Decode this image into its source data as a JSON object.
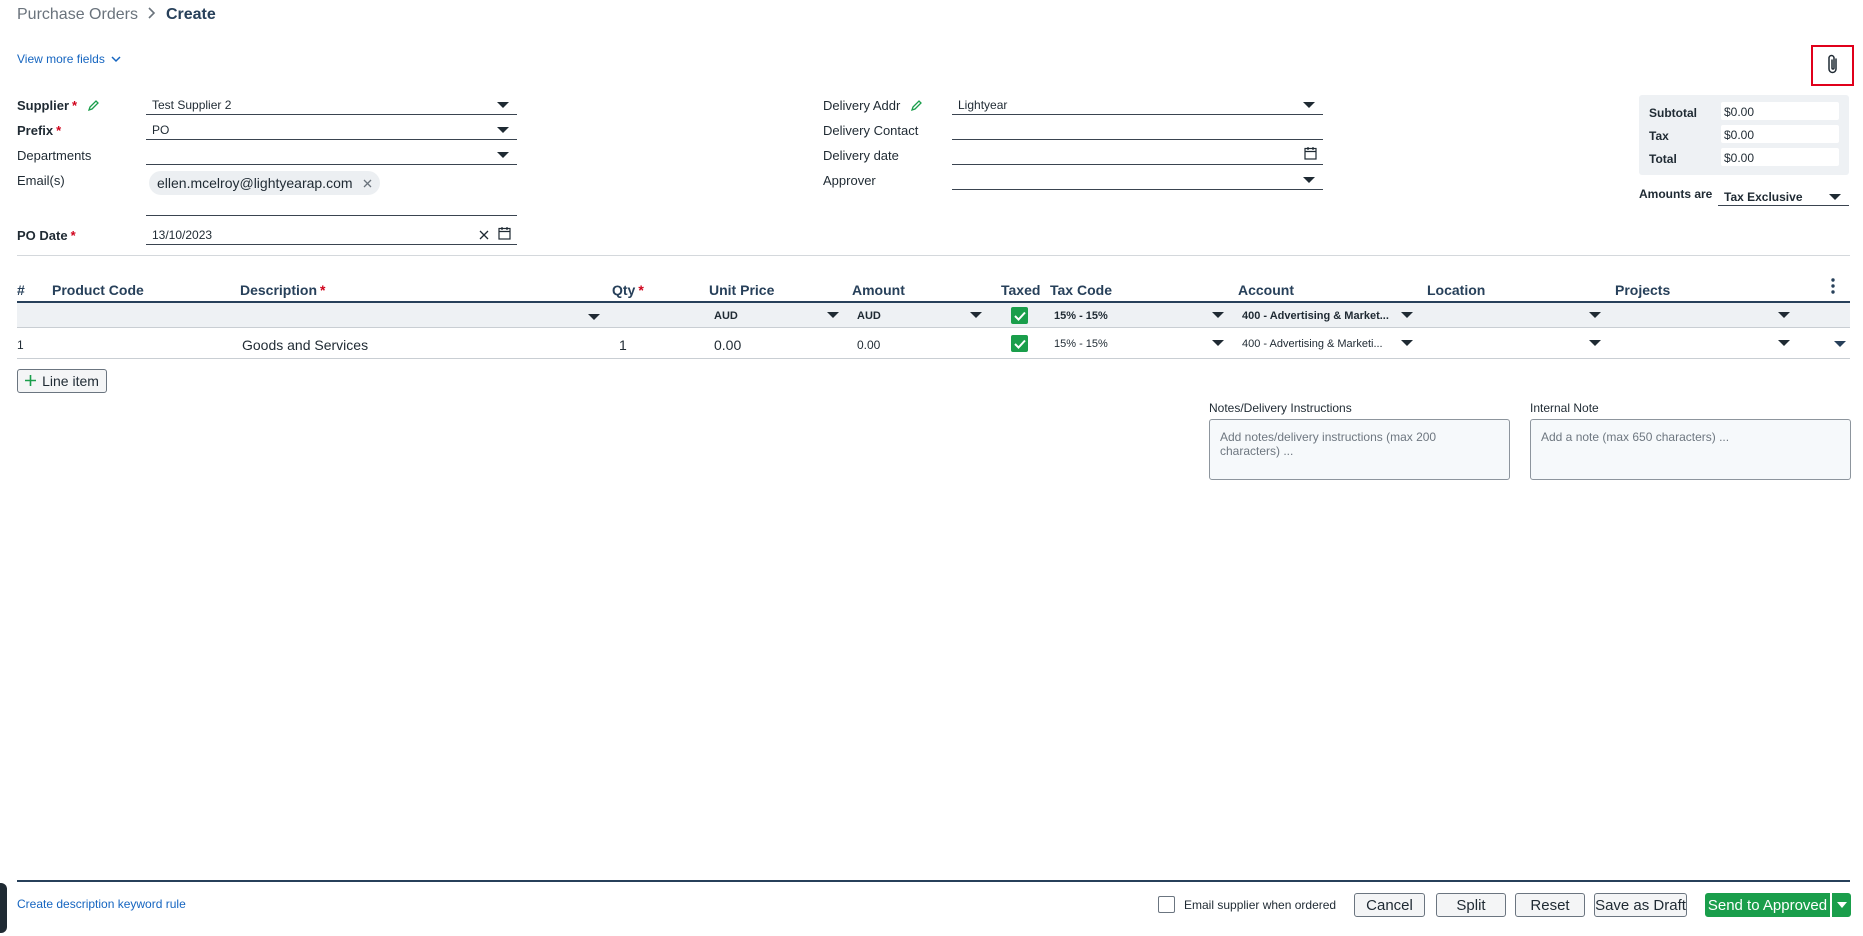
{
  "breadcrumb": {
    "parent": "Purchase Orders",
    "current": "Create"
  },
  "view_more_fields": "View more fields",
  "header_fields": {
    "supplier": {
      "label": "Supplier",
      "value": "Test Supplier 2"
    },
    "prefix": {
      "label": "Prefix",
      "value": "PO"
    },
    "departments": {
      "label": "Departments",
      "value": ""
    },
    "emails": {
      "label": "Email(s)",
      "chip": "ellen.mcelroy@lightyearap.com"
    },
    "po_date": {
      "label": "PO Date",
      "value": "13/10/2023"
    },
    "delivery_addr": {
      "label": "Delivery Addr",
      "value": "Lightyear"
    },
    "delivery_contact": {
      "label": "Delivery Contact",
      "value": ""
    },
    "delivery_date": {
      "label": "Delivery date",
      "value": ""
    },
    "approver": {
      "label": "Approver",
      "value": ""
    }
  },
  "totals": {
    "subtotal_label": "Subtotal",
    "subtotal": "$0.00",
    "tax_label": "Tax",
    "tax": "$0.00",
    "total_label": "Total",
    "total": "$0.00",
    "amounts_are_label": "Amounts are",
    "amounts_are": "Tax Exclusive"
  },
  "table": {
    "headers": {
      "num": "#",
      "product_code": "Product Code",
      "description": "Description",
      "qty": "Qty",
      "unit_price": "Unit Price",
      "amount": "Amount",
      "taxed": "Taxed",
      "tax_code": "Tax Code",
      "account": "Account",
      "location": "Location",
      "projects": "Projects"
    },
    "defaults": {
      "unit_price_currency": "AUD",
      "amount_currency": "AUD",
      "tax_code": "15% - 15%",
      "account": "400 - Advertising & Market..."
    },
    "rows": [
      {
        "num": "1",
        "product_code": "",
        "description": "Goods and Services",
        "qty": "1",
        "unit_price": "0.00",
        "amount": "0.00",
        "taxed": true,
        "tax_code": "15% - 15%",
        "account": "400 - Advertising & Marketi...",
        "location": "",
        "projects": ""
      }
    ]
  },
  "line_item_button": "Line item",
  "notes": {
    "delivery_label": "Notes/Delivery Instructions",
    "delivery_placeholder": "Add notes/delivery instructions (max 200 characters) ...",
    "internal_label": "Internal Note",
    "internal_placeholder": "Add a note (max 650 characters) ..."
  },
  "footer": {
    "keyword_rule_link": "Create description keyword rule",
    "email_supplier_label": "Email supplier when ordered",
    "cancel": "Cancel",
    "split": "Split",
    "reset": "Reset",
    "save_draft": "Save as Draft",
    "send_approved": "Send to Approved"
  },
  "colors": {
    "accent_green": "#1a9e4b",
    "link_blue": "#1565c0",
    "highlight_red": "#e0001b",
    "navy": "#27405a"
  }
}
